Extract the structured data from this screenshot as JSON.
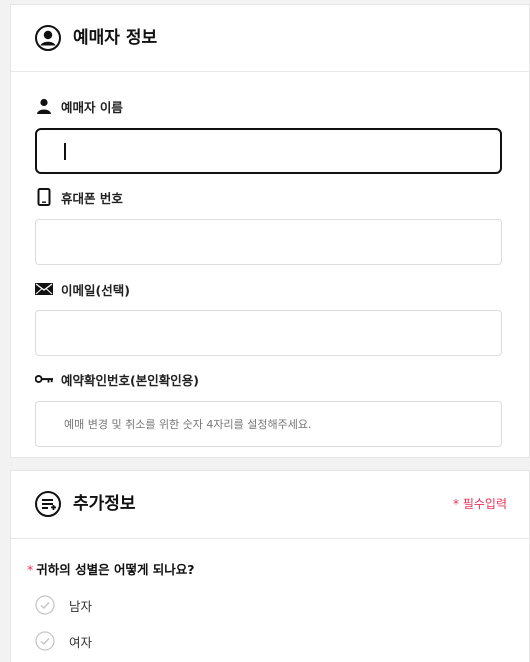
{
  "booker_section": {
    "title": "예매자 정보",
    "icon": "user-circle-icon",
    "fields": [
      {
        "label": "예매자 이름",
        "icon": "person-icon",
        "value": "",
        "placeholder": ""
      },
      {
        "label": "휴대폰 번호",
        "icon": "phone-icon",
        "value": "",
        "placeholder": ""
      },
      {
        "label": "이메일(선택)",
        "icon": "envelope-icon",
        "value": "",
        "placeholder": ""
      },
      {
        "label": "예약확인번호(본인확인용)",
        "icon": "key-icon",
        "value": "",
        "placeholder": "예매 변경 및 취소를 위한 숫자 4자리를 설정해주세요."
      }
    ]
  },
  "extra_section": {
    "title": "추가정보",
    "icon": "list-add-icon",
    "required_note": "* 필수입력",
    "question": {
      "required_mark": "*",
      "text": "귀하의 성별은 어떻게 되나요?",
      "options": [
        {
          "label": "남자"
        },
        {
          "label": "여자"
        }
      ]
    }
  },
  "colors": {
    "required": "#e6325a",
    "border": "#dcdcdc",
    "focus_border": "#111111"
  }
}
